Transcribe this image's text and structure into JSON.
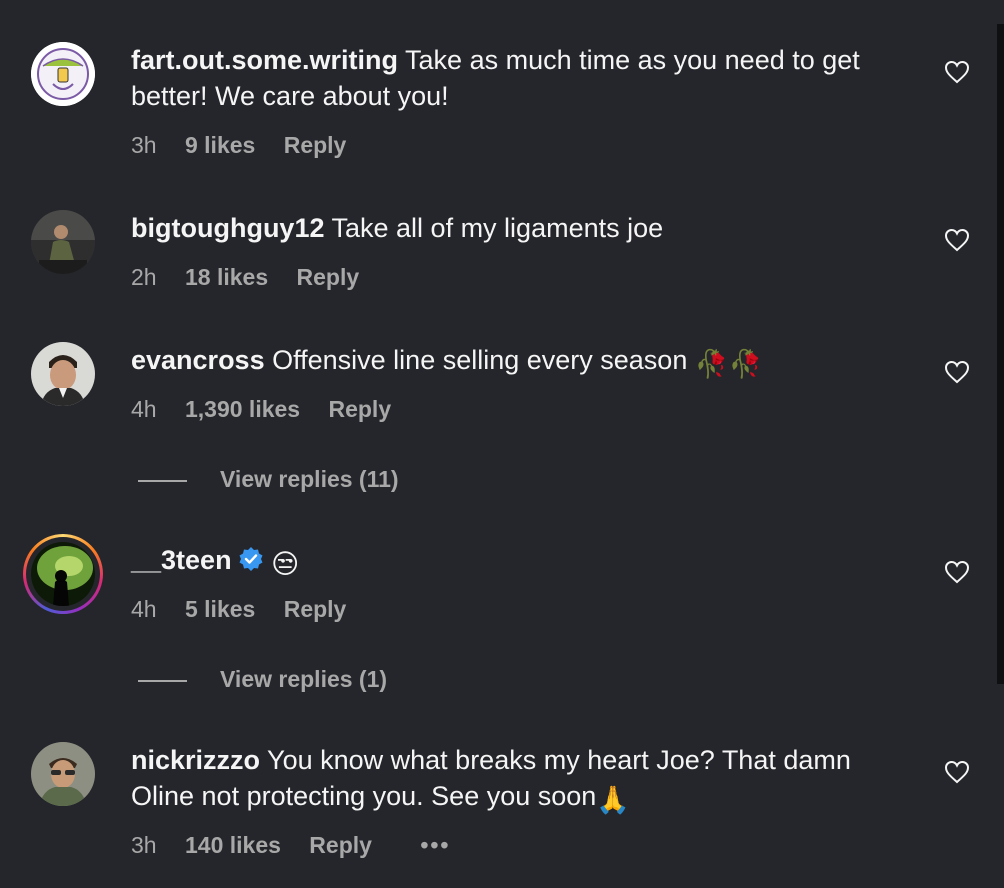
{
  "comments": [
    {
      "username": "fart.out.some.writing",
      "text": "Take as much time as you need to get better! We care about you!",
      "time": "3h",
      "likes": "9 likes",
      "reply": "Reply"
    },
    {
      "username": "bigtoughguy12",
      "text": "Take all of my ligaments joe",
      "time": "2h",
      "likes": "18 likes",
      "reply": "Reply"
    },
    {
      "username": "evancross",
      "text": "Offensive line selling every season",
      "emoji": "🥀🥀",
      "time": "4h",
      "likes": "1,390 likes",
      "reply": "Reply",
      "view_replies": "View replies (11)"
    },
    {
      "username": "__3teen",
      "emoji": "😒",
      "time": "4h",
      "likes": "5 likes",
      "reply": "Reply",
      "view_replies": "View replies (1)"
    },
    {
      "username": "nickrizzzo",
      "text": "You know what breaks my heart Joe? That damn Oline not protecting you. See you soon",
      "emoji": "🙏",
      "time": "3h",
      "likes": "140 likes",
      "reply": "Reply",
      "more": "•••"
    }
  ],
  "colors": {
    "background": "#25262b",
    "primary_text": "#f5f5f5",
    "secondary_text": "#a8a8a8",
    "verified": "#3897f0"
  }
}
